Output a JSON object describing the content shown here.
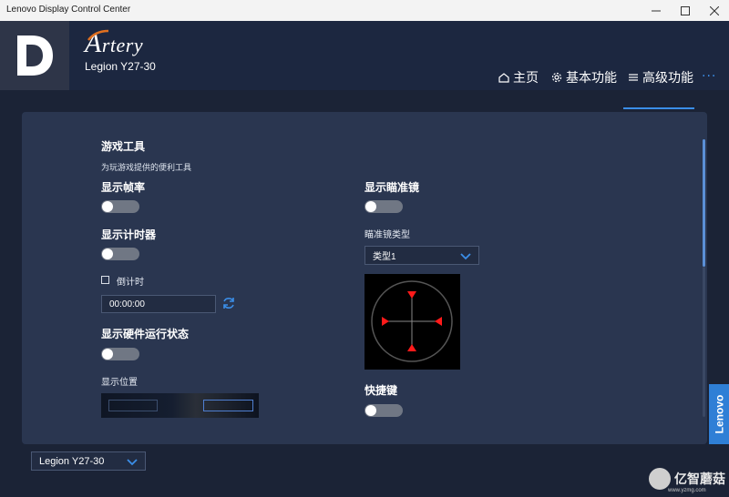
{
  "window": {
    "title": "Lenovo Display Control Center"
  },
  "header": {
    "brand": "rtery",
    "brand_initial": "A",
    "model": "Legion Y27-30"
  },
  "nav": {
    "home": "主页",
    "basic": "基本功能",
    "advanced": "高级功能",
    "more": "···"
  },
  "game_tools": {
    "title": "游戏工具",
    "subtitle": "为玩游戏提供的便利工具",
    "show_fps": {
      "label": "显示帧率",
      "enabled": false
    },
    "show_timer": {
      "label": "显示计时器",
      "enabled": false
    },
    "countdown": {
      "label": "倒计时",
      "checked": false
    },
    "time_value": "00:00:00",
    "show_hardware": {
      "label": "显示硬件运行状态",
      "enabled": false
    },
    "display_position": {
      "label": "显示位置"
    },
    "show_crosshair": {
      "label": "显示瞄准镜",
      "enabled": false
    },
    "crosshair_type": {
      "label": "瞄准镜类型",
      "selected": "类型1"
    },
    "hotkey": {
      "label": "快捷键",
      "enabled": false
    }
  },
  "footer": {
    "model_select": "Legion Y27-30"
  },
  "side_tab": {
    "label": "Lenovo"
  },
  "watermark": {
    "text": "亿智蘑菇",
    "url": "www.yzmg.com"
  },
  "colors": {
    "accent": "#3b8ee8",
    "panel": "#2a3650",
    "background": "#1b2336",
    "crosshair_marker": "#ff1a1a"
  }
}
